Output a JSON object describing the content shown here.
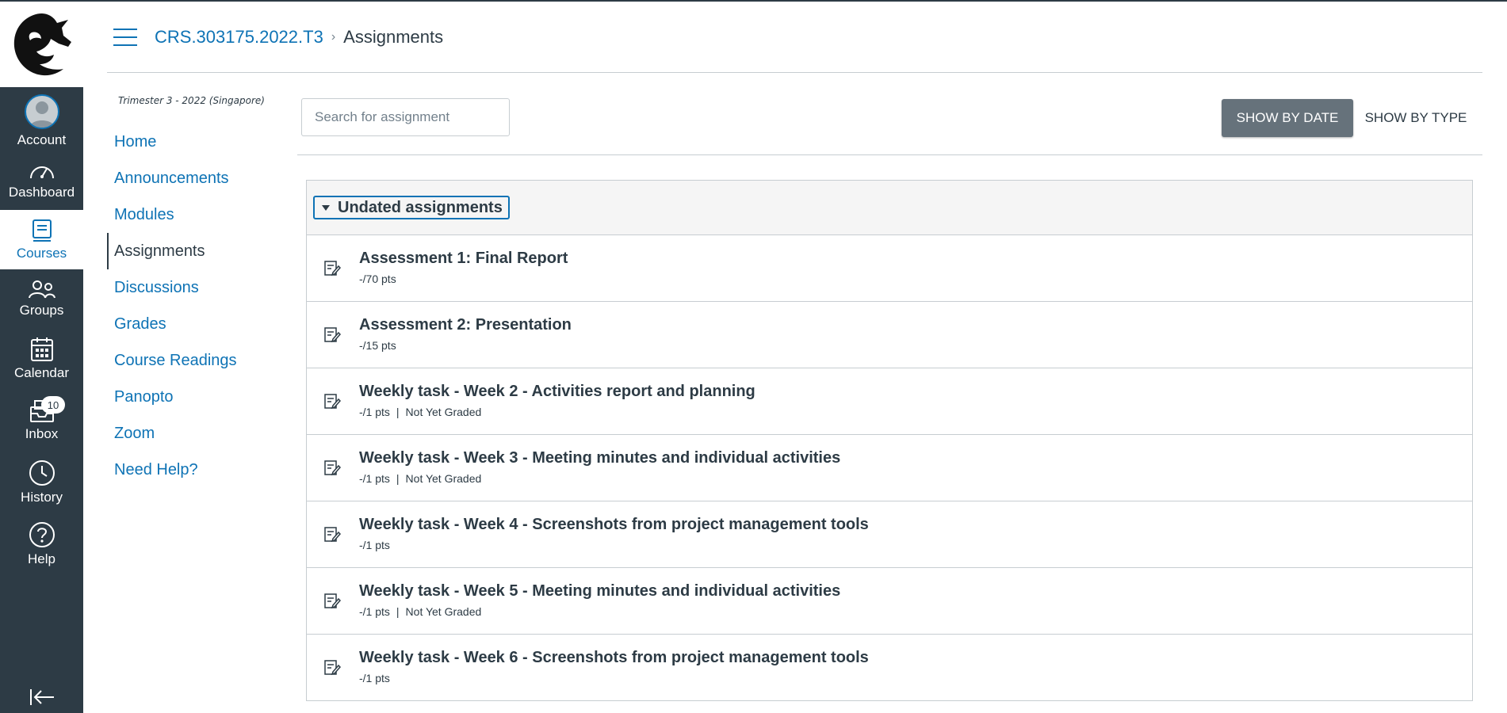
{
  "global_nav": {
    "account": "Account",
    "dashboard": "Dashboard",
    "courses": "Courses",
    "groups": "Groups",
    "calendar": "Calendar",
    "inbox": "Inbox",
    "inbox_badge": "10",
    "history": "History",
    "help": "Help"
  },
  "header": {
    "course_code": "CRS.303175.2022.T3",
    "separator": "›",
    "current": "Assignments"
  },
  "course_nav": {
    "term": "Trimester 3 - 2022 (Singapore)",
    "items": [
      {
        "label": "Home"
      },
      {
        "label": "Announcements"
      },
      {
        "label": "Modules"
      },
      {
        "label": "Assignments"
      },
      {
        "label": "Discussions"
      },
      {
        "label": "Grades"
      },
      {
        "label": "Course Readings"
      },
      {
        "label": "Panopto"
      },
      {
        "label": "Zoom"
      },
      {
        "label": "Need Help?"
      }
    ]
  },
  "toolbar": {
    "search_placeholder": "Search for assignment",
    "show_by_date": "SHOW BY DATE",
    "show_by_type": "SHOW BY TYPE"
  },
  "group": {
    "title": "Undated assignments",
    "assignments": [
      {
        "title": "Assessment 1: Final Report",
        "points": "-/70 pts",
        "status": ""
      },
      {
        "title": "Assessment 2: Presentation",
        "points": "-/15 pts",
        "status": ""
      },
      {
        "title": "Weekly task - Week 2 - Activities report and planning",
        "points": "-/1 pts",
        "separator": "|",
        "status": "Not Yet Graded"
      },
      {
        "title": "Weekly task - Week 3 - Meeting minutes and individual activities",
        "points": "-/1 pts",
        "separator": "|",
        "status": "Not Yet Graded"
      },
      {
        "title": "Weekly task - Week 4 - Screenshots from project management tools",
        "points": "-/1 pts",
        "status": ""
      },
      {
        "title": "Weekly task - Week 5 - Meeting minutes and individual activities",
        "points": "-/1 pts",
        "separator": "|",
        "status": "Not Yet Graded"
      },
      {
        "title": "Weekly task - Week 6 - Screenshots from project management tools",
        "points": "-/1 pts",
        "status": ""
      }
    ]
  },
  "colors": {
    "nav_bg": "#2d3b45",
    "link": "#0e73b5",
    "button_bg": "#66727b",
    "group_head_bg": "#f5f5f5",
    "border": "#c7cdd1"
  }
}
